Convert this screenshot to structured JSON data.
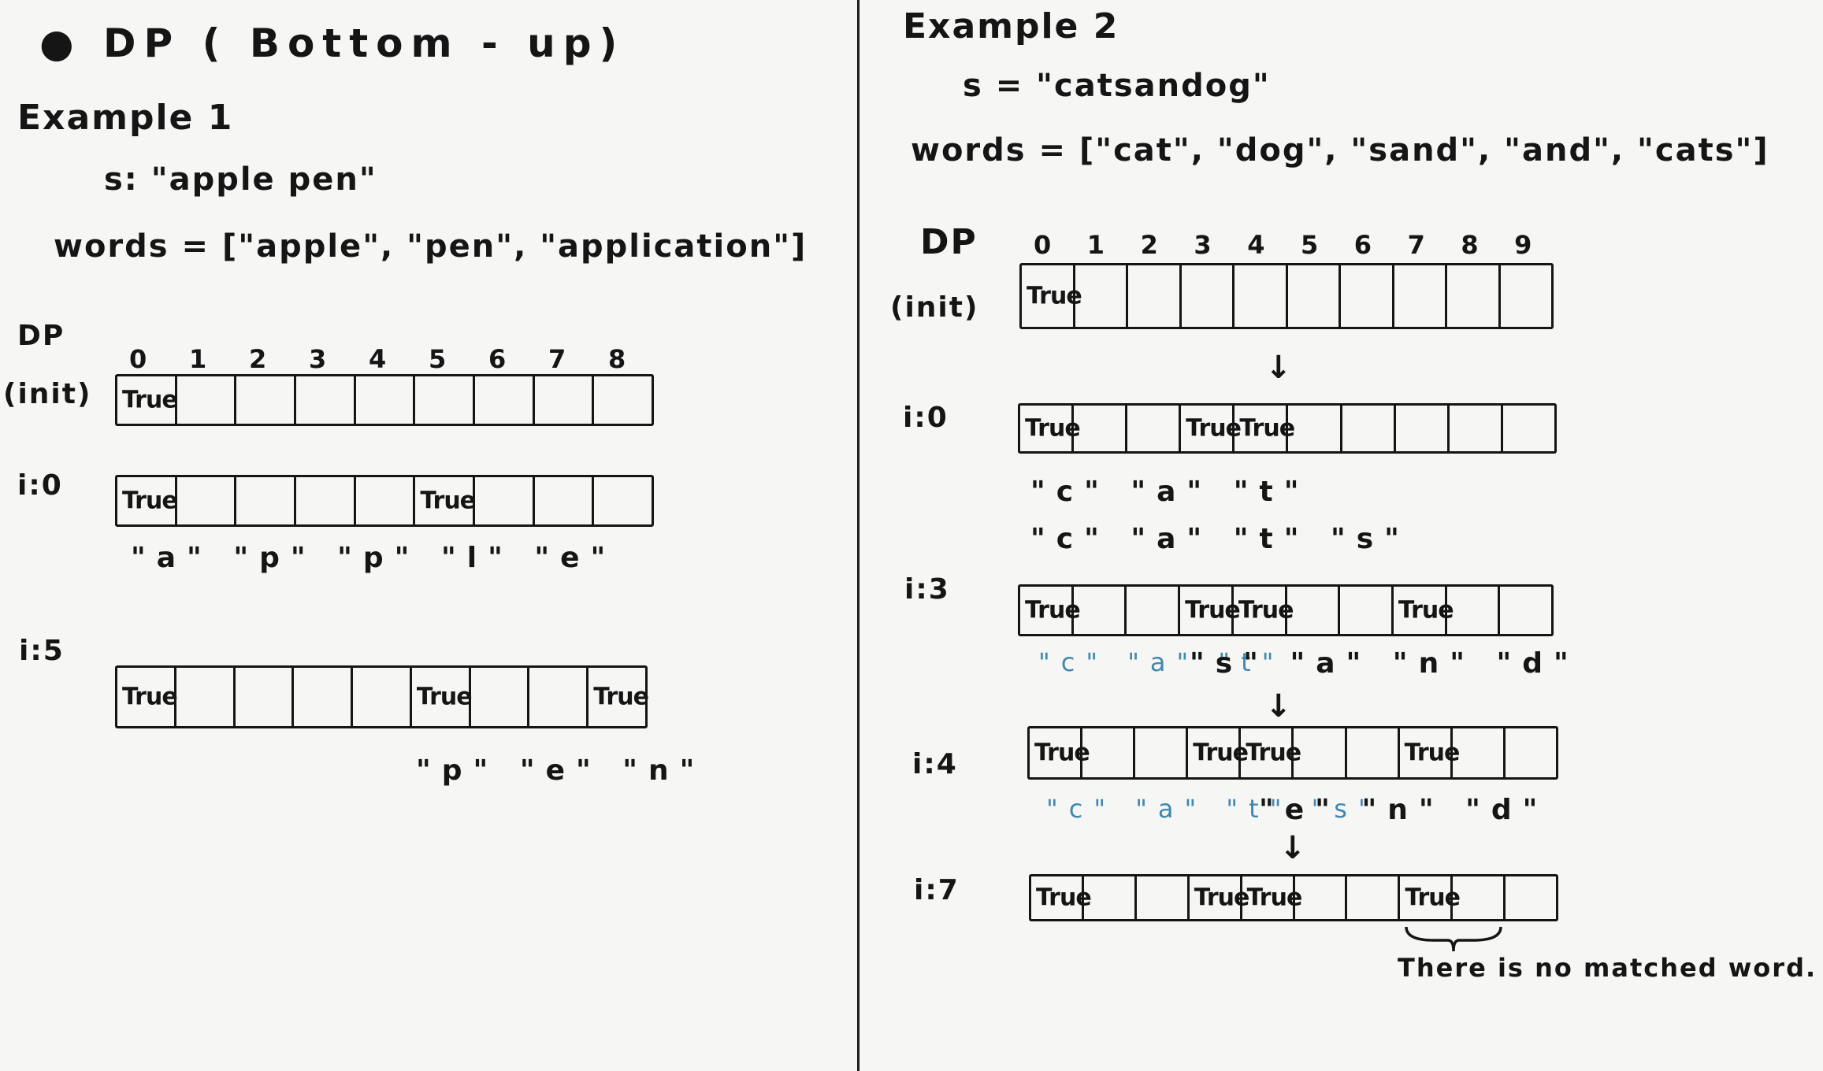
{
  "left": {
    "title": "● DP ( Bottom - up)",
    "example_label": "Example 1",
    "s_line": "s: \"apple pen\"",
    "words_line": "words = [\"apple\", \"pen\", \"application\"]",
    "dp_label": "DP",
    "init_label": "(init)",
    "indices": [
      "0",
      "1",
      "2",
      "3",
      "4",
      "5",
      "6",
      "7",
      "8"
    ],
    "rows": [
      {
        "label": "",
        "cells": [
          "True",
          "",
          "",
          "",
          "",
          "",
          "",
          "",
          ""
        ]
      },
      {
        "label": "i:0",
        "cells": [
          "True",
          "",
          "",
          "",
          "",
          "True",
          "",
          "",
          ""
        ],
        "chars": "\"a\" \"p\" \"p\" \"l\" \"e\""
      },
      {
        "label": "i:5",
        "cells": [
          "True",
          "",
          "",
          "",
          "",
          "True",
          "",
          "",
          "True"
        ],
        "chars": "\"p\" \"e\" \"n\""
      }
    ]
  },
  "right": {
    "example_label": "Example 2",
    "s_line": "s = \"catsandog\"",
    "words_line": "words = [\"cat\", \"dog\", \"sand\", \"and\", \"cats\"]",
    "dp_label": "DP",
    "init_label": "(init)",
    "indices": [
      "0",
      "1",
      "2",
      "3",
      "4",
      "5",
      "6",
      "7",
      "8",
      "9"
    ],
    "rows": [
      {
        "label": "",
        "cells": [
          "True",
          "",
          "",
          "",
          "",
          "",
          "",
          "",
          "",
          ""
        ]
      },
      {
        "label": "i:0",
        "cells": [
          "True",
          "",
          "",
          "True",
          "True",
          "",
          "",
          "",
          "",
          ""
        ],
        "chars1": "\"c\" \"a\" \"t\"",
        "chars2": "\"c\" \"a\" \"t\" \"s\""
      },
      {
        "label": "i:3",
        "cells": [
          "True",
          "",
          "",
          "True",
          "True",
          "",
          "",
          "True",
          "",
          ""
        ],
        "chars_blue": "\"c\" \"a\" \"t\"",
        "chars_black": "\"s\" \"a\" \"n\" \"d\""
      },
      {
        "label": "i:4",
        "cells": [
          "True",
          "",
          "",
          "True",
          "True",
          "",
          "",
          "True",
          "",
          ""
        ],
        "chars_blue": "\"c\" \"a\" \"t\" \"s\"",
        "chars_black": "\"e\" \"n\" \"d\""
      },
      {
        "label": "i:7",
        "cells": [
          "True",
          "",
          "",
          "True",
          "True",
          "",
          "",
          "True",
          "",
          ""
        ]
      }
    ],
    "note": "There is no matched word."
  }
}
